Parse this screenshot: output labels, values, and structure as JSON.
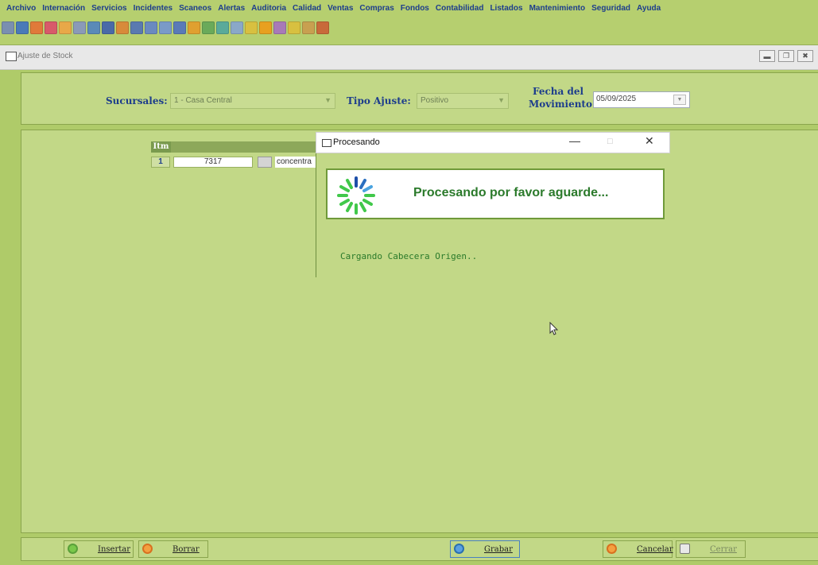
{
  "menu": [
    "Archivo",
    "Internación",
    "Servicios",
    "Incidentes",
    "Scaneos",
    "Alertas",
    "Auditoria",
    "Calidad",
    "Ventas",
    "Compras",
    "Fondos",
    "Contabilidad",
    "Listados",
    "Mantenimiento",
    "Seguridad",
    "Ayuda"
  ],
  "window": {
    "title": "Ajuste de Stock"
  },
  "header": {
    "sucursales_label": "Sucursales:",
    "sucursales_value": "1 - Casa Central",
    "tipo_ajuste_label": "Tipo Ajuste:",
    "tipo_ajuste_value": "Positivo",
    "fecha_label_1": "Fecha del",
    "fecha_label_2": "Movimiento:",
    "fecha_value": "05/09/2025"
  },
  "grid": {
    "col_itm": "Itm",
    "rows": [
      {
        "num": "1",
        "code": "7317",
        "desc": "concentra"
      }
    ]
  },
  "dialog": {
    "title": "Procesando",
    "message": "Procesando por favor aguarde...",
    "status": "Cargando Cabecera Origen.."
  },
  "footer": {
    "insertar": "Insertar",
    "borrar": "Borrar",
    "grabar": "Grabar",
    "cancelar": "Cancelar",
    "cerrar": "Cerrar"
  },
  "colors": {
    "accent_green": "#afcb69",
    "menu_text": "#1d3d8c",
    "message_text": "#2b7a2b"
  }
}
